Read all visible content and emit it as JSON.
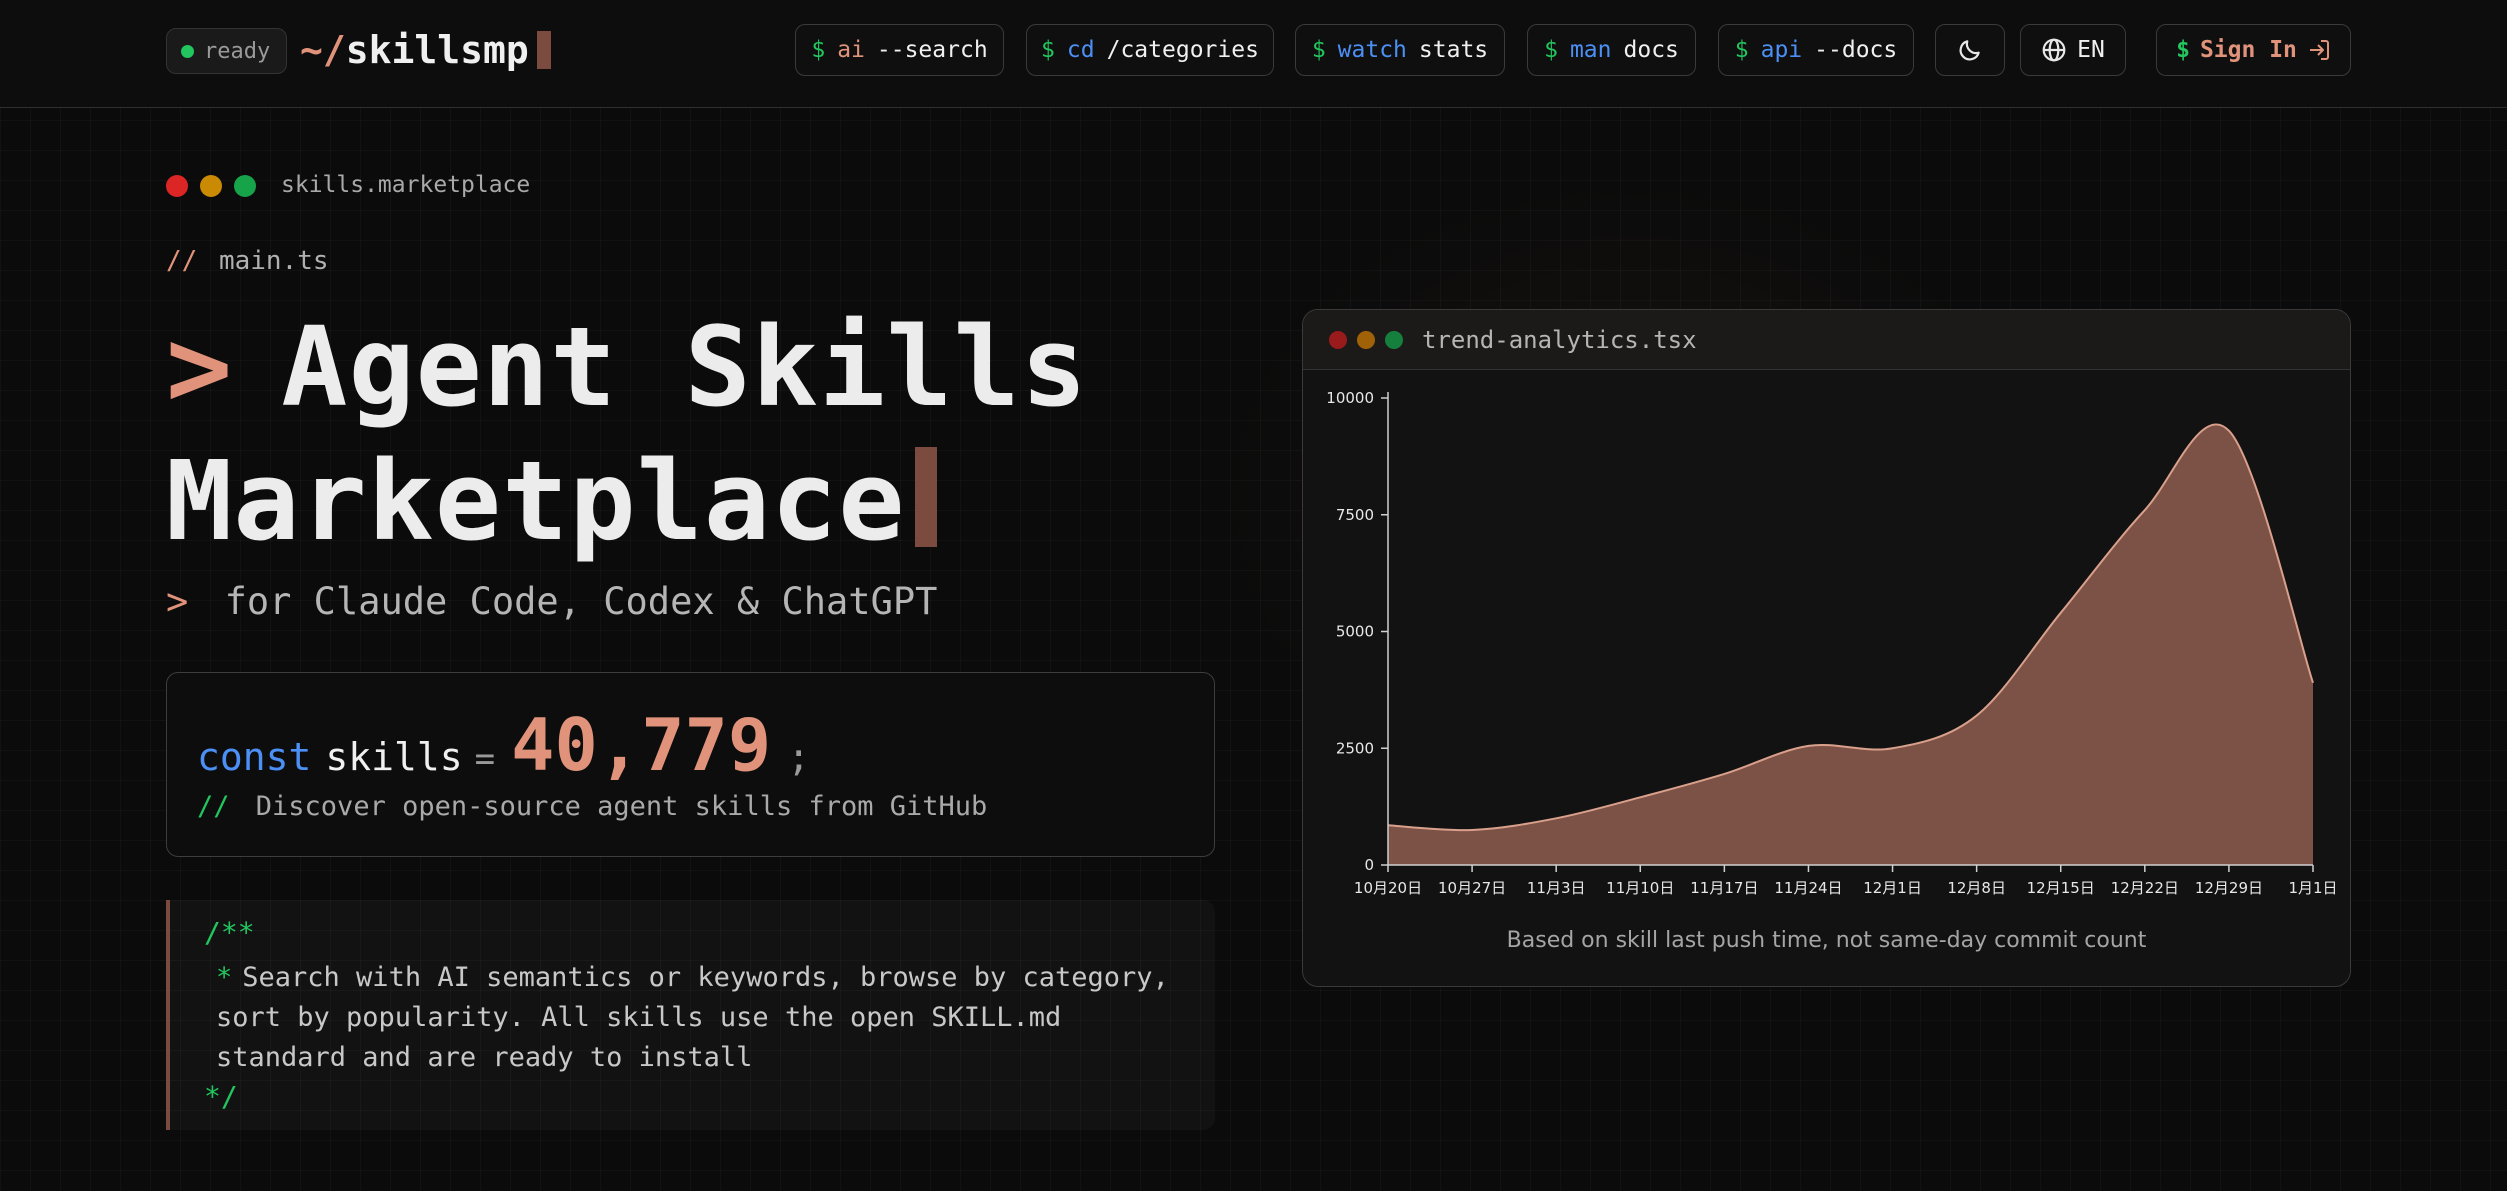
{
  "header": {
    "status": "ready",
    "logo_prefix": "~/",
    "logo_name": "skillsmp",
    "nav": [
      {
        "sign": "$",
        "cmd": "ai",
        "arg": "--search"
      },
      {
        "sign": "$",
        "cmd": "cd",
        "arg": "/categories"
      },
      {
        "sign": "$",
        "cmd": "watch",
        "arg": "stats"
      },
      {
        "sign": "$",
        "cmd": "man",
        "arg": "docs"
      },
      {
        "sign": "$",
        "cmd": "api",
        "arg": "--docs"
      }
    ],
    "theme_icon": "moon-icon",
    "language_icon": "globe-icon",
    "language": "EN",
    "signin_sign": "$",
    "signin_label": "Sign In",
    "signin_icon": "sign-in-icon"
  },
  "hero": {
    "window_title": "skills.marketplace",
    "comment_slash": "//",
    "file_name": "main.ts",
    "prompt": ">",
    "title_line1": "Agent Skills",
    "title_line2": "Marketplace",
    "subtitle_prompt": ">",
    "subtitle": "for Claude Code, Codex & ChatGPT",
    "code_keyword": "const",
    "code_var": "skills",
    "code_eq": "=",
    "skill_count": "40,779",
    "code_semi": ";",
    "code_comment_slash": "//",
    "code_comment": "Discover open-source agent skills from GitHub",
    "doc_open": "/**",
    "doc_star": "*",
    "doc_text": "Search with AI semantics or keywords, browse by category, sort by popularity. All skills use the open SKILL.md standard and are ready to install",
    "doc_close": "*/"
  },
  "chart_window": {
    "title": "trend-analytics.tsx",
    "caption": "Based on skill last push time, not same-day commit count"
  },
  "chart_data": {
    "type": "area",
    "x_tick_labels": [
      "10月20日",
      "10月27日",
      "11月3日",
      "11月10日",
      "11月17日",
      "11月24日",
      "12月1日",
      "12月8日",
      "12月15日",
      "12月22日",
      "12月29日",
      "1月1日"
    ],
    "y_tick_labels": [
      "0",
      "2500",
      "5000",
      "7500",
      "10000"
    ],
    "ylim": [
      0,
      10000
    ],
    "series": [
      {
        "points": [
          [
            "10月20日",
            850
          ],
          [
            "10月27日",
            750
          ],
          [
            "11月3日",
            1000
          ],
          [
            "11月10日",
            1450
          ],
          [
            "11月17日",
            1950
          ],
          [
            "11月24日",
            2550
          ],
          [
            "12月1日",
            2500
          ],
          [
            "12月8日",
            3200
          ],
          [
            "12月15日",
            5400
          ],
          [
            "12月22日",
            7600
          ],
          [
            "12月29日",
            9300
          ],
          [
            "1月1日",
            3900
          ]
        ]
      }
    ],
    "fill_color": "#8a5a4c",
    "stroke_color": "#d9a08c",
    "grid": false
  },
  "colors": {
    "accent": "#e0937a",
    "green": "#22c55e",
    "blue": "#4c8ff5"
  }
}
